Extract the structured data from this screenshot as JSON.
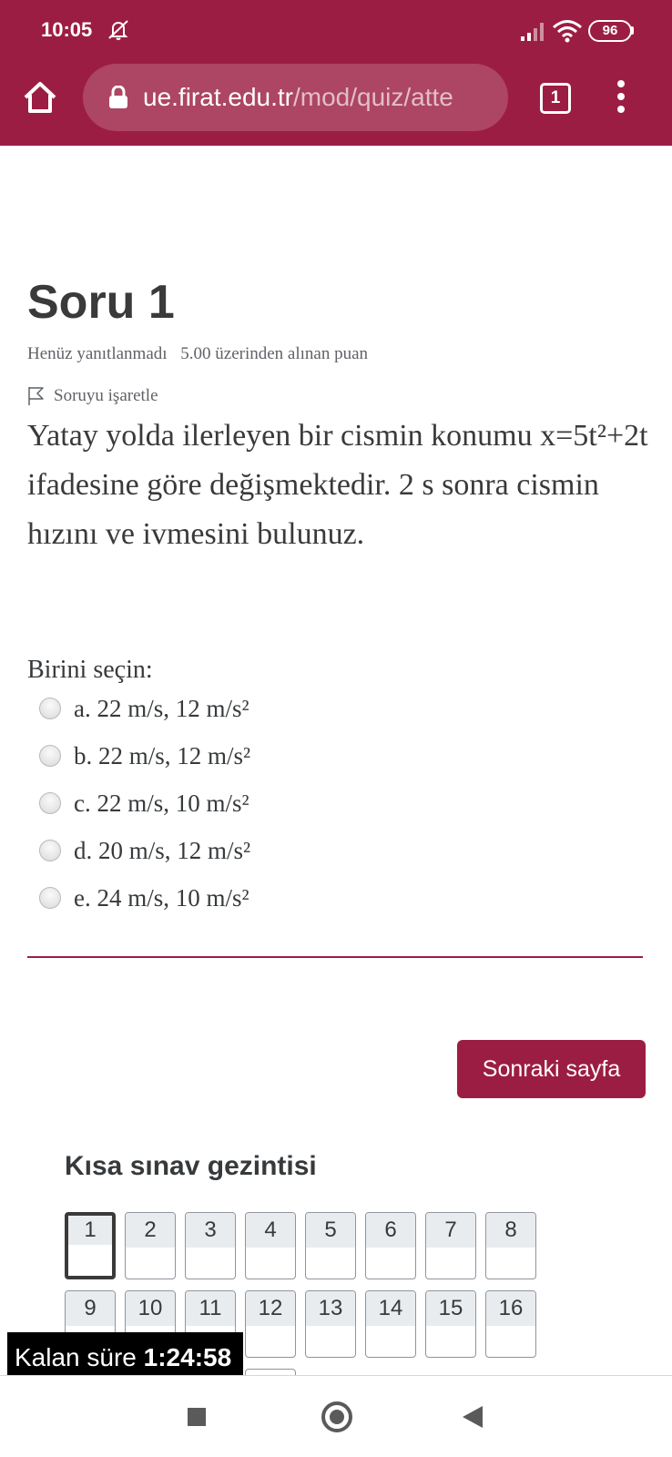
{
  "status_bar": {
    "time": "10:05",
    "battery": "96"
  },
  "browser": {
    "url_host": "ue.firat.edu.tr",
    "url_path": "/mod/quiz/atte",
    "tab_count": "1"
  },
  "question": {
    "title": "Soru 1",
    "state": "Henüz yanıtlanmadı",
    "grade": "5.00 üzerinden alınan puan",
    "flag_label": "Soruyu işaretle",
    "text": "Yatay yolda ilerleyen bir cismin konumu x=5t²+2t ifadesine göre değişmektedir. 2 s sonra cismin hızını ve ivmesini bulunuz.",
    "prompt": "Birini seçin:",
    "options": [
      "a. 22 m/s, 12 m/s²",
      "b. 22 m/s, 12 m/s²",
      "c. 22 m/s, 10 m/s²",
      "d. 20 m/s, 12 m/s²",
      "e. 24 m/s, 10 m/s²"
    ]
  },
  "next_button": "Sonraki sayfa",
  "quiz_nav": {
    "title": "Kısa sınav gezintisi",
    "buttons": [
      "1",
      "2",
      "3",
      "4",
      "5",
      "6",
      "7",
      "8",
      "9",
      "10",
      "11",
      "12",
      "13",
      "14",
      "15",
      "16"
    ],
    "current": "1"
  },
  "timer": {
    "label": "Kalan süre",
    "value": "1:24:58"
  },
  "colors": {
    "brand": "#9c1d44",
    "text": "#373a3c"
  }
}
